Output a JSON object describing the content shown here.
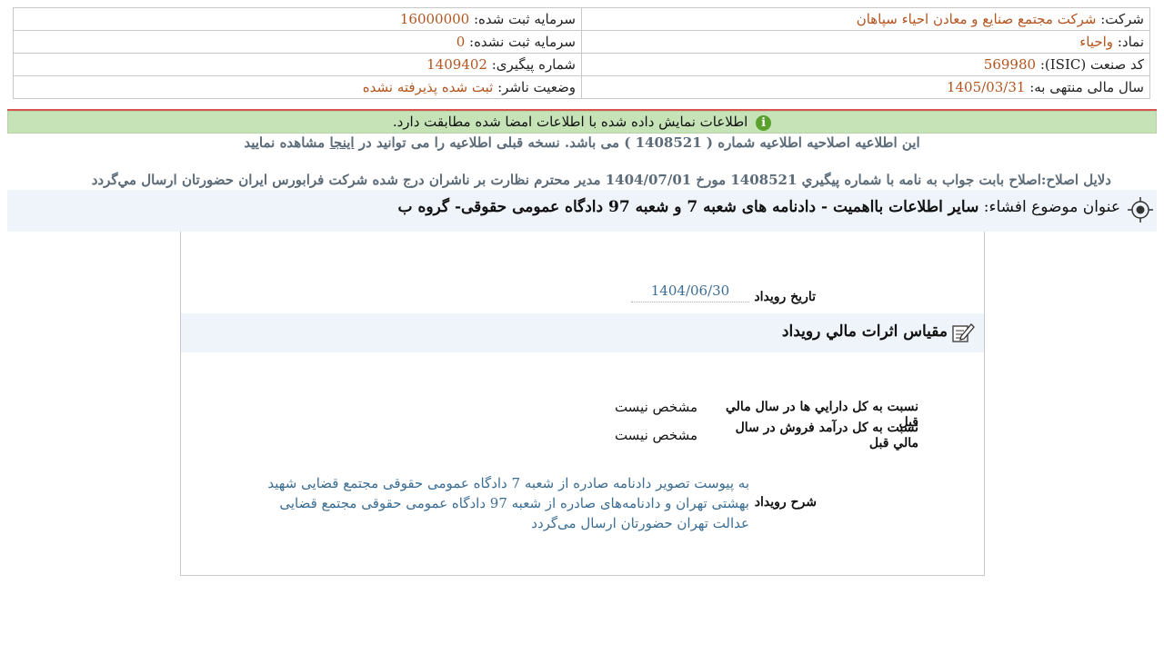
{
  "header": {
    "company_label": "شرکت:",
    "company_value": "شرکت مجتمع صنایع و معادن احیاء سپاهان",
    "reg_capital_label": "سرمایه ثبت شده:",
    "reg_capital_value": "16000000",
    "symbol_label": "نماد:",
    "symbol_value": "واحیاء",
    "unreg_capital_label": "سرمایه ثبت نشده:",
    "unreg_capital_value": "0",
    "isic_label": "کد صنعت (ISIC):",
    "isic_value": "569980",
    "tracking_label": "شماره پیگیری:",
    "tracking_value": "1409402",
    "fiscal_label": "سال مالی منتهی به:",
    "fiscal_value": "1405/03/31",
    "publisher_label": "وضعیت ناشر:",
    "publisher_value": "ثبت شده پذیرفته نشده"
  },
  "notice": {
    "icon": "info-icon",
    "icon_glyph": "i",
    "text": "اطلاعات نمایش داده شده با اطلاعات امضا شده مطابقت دارد."
  },
  "correction": {
    "text_before": "این اطلاعیه اصلاحیه اطلاعیه شماره ( 1408521 ) می باشد. نسخه قبلی اطلاعیه را می توانید در",
    "link_text": "اینجا",
    "text_after": "مشاهده نمایید",
    "reasons": "دلایل اصلاح:اصلاح بابت جواب به نامه با شماره پیگيري 1408521 مورخ 1404/07/01 مدیر محترم نظارت بر ناشران درج شده شرکت فرابورس ایران حضورتان ارسال مي‌گردد"
  },
  "subject": {
    "label": "عنوان موضوع افشاء:",
    "value": "سایر اطلاعات بااهمیت - دادنامه های شعبه 7 و شعبه 97 دادگاه عمومی حقوقی- گروه ب"
  },
  "event": {
    "date_label": "تاريخ رويداد",
    "date_value": "1404/06/30",
    "section_title": "مقياس اثرات مالي رويداد",
    "ratio_assets_label": "نسبت به کل دارايي ها در سال مالي قبل",
    "ratio_assets_value": "مشخص نيست",
    "ratio_revenue_label": "نسبت به کل درآمد فروش در سال مالي قبل",
    "ratio_revenue_value": "مشخص نيست",
    "desc_label": "شرح رويداد",
    "desc_value": "به پیوست تصویر دادنامه صادره از شعبه 7 دادگاه عمومی حقوقی مجتمع قضایی شهید بهشتی تهران و دادنامه‌های صادره از شعبه 97 دادگاه عمومی حقوقی مجتمع قضایی عدالت تهران حضورتان ارسال می‌گردد"
  },
  "colors": {
    "value_orange": "#b3541e",
    "value_blue": "#3b6d94",
    "notice_green": "#c6e3b8",
    "subject_bg": "#eef4fa",
    "divider_red": "#d9534f"
  }
}
